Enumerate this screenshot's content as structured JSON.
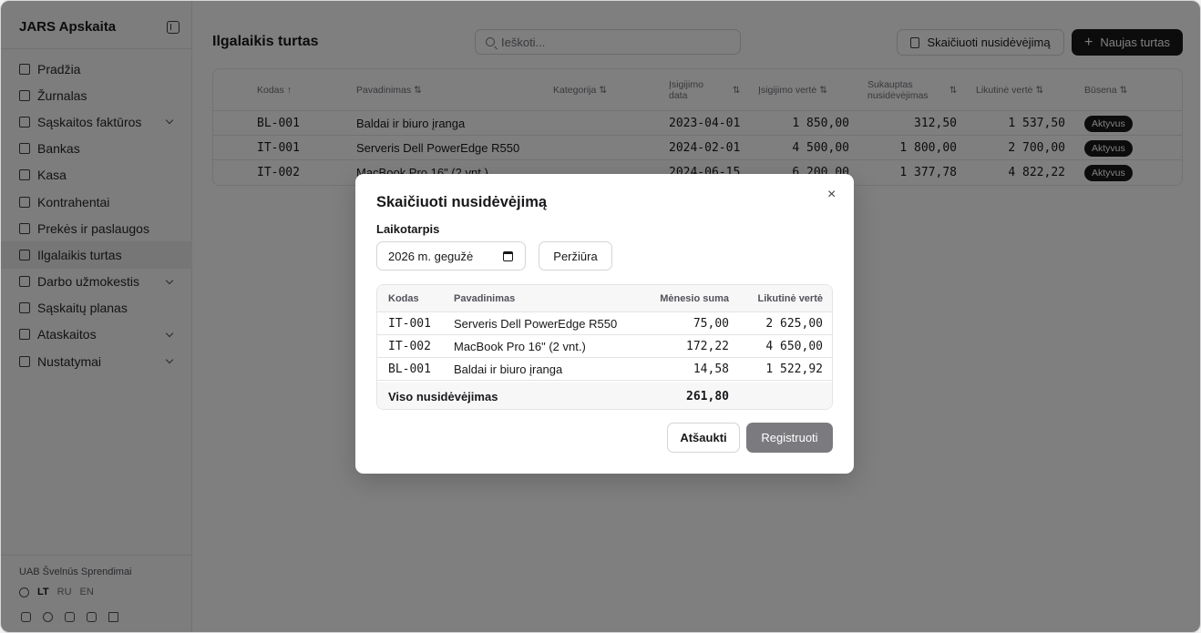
{
  "app": {
    "name": "JARS Apskaita",
    "company": "UAB Švelnūs Sprendimai"
  },
  "sidebar": {
    "items": [
      {
        "label": "Pradžia",
        "icon": "home-icon"
      },
      {
        "label": "Žurnalas",
        "icon": "book-icon"
      },
      {
        "label": "Sąskaitos faktūros",
        "icon": "invoice-icon",
        "expandable": true
      },
      {
        "label": "Bankas",
        "icon": "bank-icon"
      },
      {
        "label": "Kasa",
        "icon": "cash-icon"
      },
      {
        "label": "Kontrahentai",
        "icon": "users-icon"
      },
      {
        "label": "Prekės ir paslaugos",
        "icon": "package-icon"
      },
      {
        "label": "Ilgalaikis turtas",
        "icon": "asset-icon",
        "active": true
      },
      {
        "label": "Darbo užmokestis",
        "icon": "payroll-icon",
        "expandable": true
      },
      {
        "label": "Sąskaitų planas",
        "icon": "list-icon"
      },
      {
        "label": "Ataskaitos",
        "icon": "chart-icon",
        "expandable": true
      },
      {
        "label": "Nustatymai",
        "icon": "gear-icon",
        "expandable": true
      }
    ],
    "languages": [
      "LT",
      "RU",
      "EN"
    ],
    "active_language": "LT"
  },
  "page": {
    "title": "Ilgalaikis turtas",
    "search_placeholder": "Ieškoti...",
    "calc_button": "Skaičiuoti nusidėvėjimą",
    "new_button": "Naujas turtas",
    "new_button_icon": "+"
  },
  "table": {
    "headers": {
      "code": "Kodas ↑",
      "name": "Pavadinimas ⇅",
      "category": "Kategorija ⇅",
      "date1": "Įsigijimo",
      "date2": "data",
      "value": "Įsigijimo vertė ⇅",
      "accum1": "Sukauptas",
      "accum2": "nusidėvėjimas",
      "residual": "Likutinė vertė ⇅",
      "status": "Būsena ⇅"
    },
    "rows": [
      {
        "code": "BL-001",
        "name": "Baldai ir biuro įranga",
        "category": "",
        "date": "2023-04-01",
        "value": "1 850,00",
        "accum": "312,50",
        "residual": "1 537,50",
        "status": "Aktyvus"
      },
      {
        "code": "IT-001",
        "name": "Serveris Dell PowerEdge R550",
        "category": "",
        "date": "2024-02-01",
        "value": "4 500,00",
        "accum": "1 800,00",
        "residual": "2 700,00",
        "status": "Aktyvus"
      },
      {
        "code": "IT-002",
        "name": "MacBook Pro 16\" (2 vnt.)",
        "category": "",
        "date": "2024-06-15",
        "value": "6 200,00",
        "accum": "1 377,78",
        "residual": "4 822,22",
        "status": "Aktyvus"
      }
    ]
  },
  "modal": {
    "title": "Skaičiuoti nusidėvėjimą",
    "period_label": "Laikotarpis",
    "period_value": "2026 m. gegužė",
    "preview_button": "Peržiūra",
    "headers": {
      "code": "Kodas",
      "name": "Pavadinimas",
      "monthly": "Mėnesio suma",
      "residual": "Likutinė vertė"
    },
    "rows": [
      {
        "code": "IT-001",
        "name": "Serveris Dell PowerEdge R550",
        "monthly": "75,00",
        "residual": "2 625,00"
      },
      {
        "code": "IT-002",
        "name": "MacBook Pro 16\" (2 vnt.)",
        "monthly": "172,22",
        "residual": "4 650,00"
      },
      {
        "code": "BL-001",
        "name": "Baldai ir biuro įranga",
        "monthly": "14,58",
        "residual": "1 522,92"
      }
    ],
    "total_label": "Viso nusidėvėjimas",
    "total_value": "261,80",
    "cancel_button": "Atšaukti",
    "submit_button": "Registruoti",
    "close_symbol": "×"
  }
}
